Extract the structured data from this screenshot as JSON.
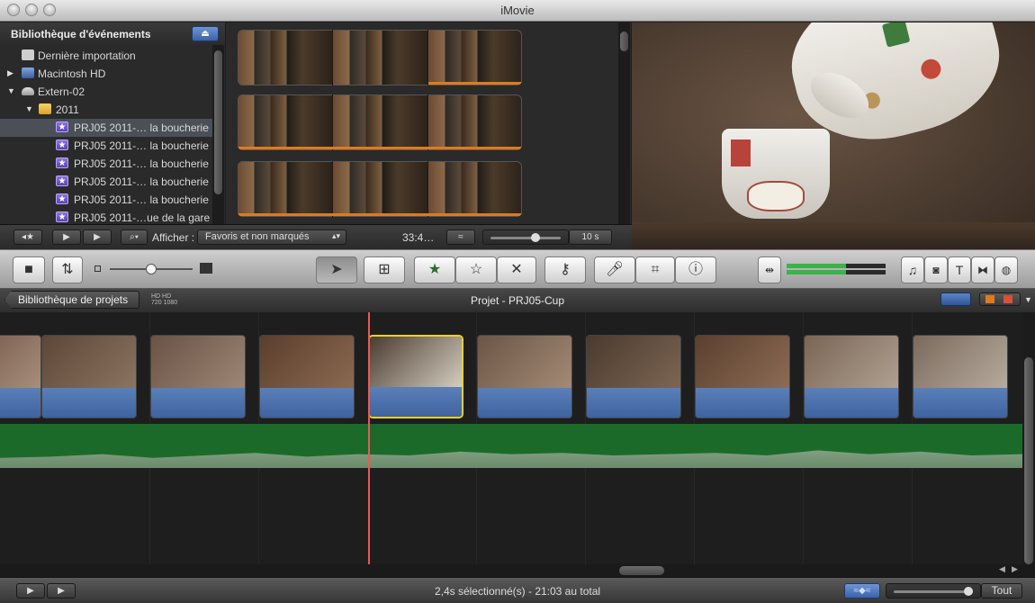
{
  "window": {
    "title": "iMovie"
  },
  "event_library": {
    "title": "Bibliothèque d'événements",
    "items": [
      {
        "label": "Dernière importation",
        "kind": "import"
      },
      {
        "label": "Macintosh HD",
        "kind": "disk"
      },
      {
        "label": "Extern-02",
        "kind": "disk"
      },
      {
        "label": "2011",
        "kind": "calendar"
      },
      {
        "label": "PRJ05 2011-… la boucherie",
        "kind": "event",
        "selected": true
      },
      {
        "label": "PRJ05 2011-… la boucherie",
        "kind": "event"
      },
      {
        "label": "PRJ05 2011-… la boucherie",
        "kind": "event"
      },
      {
        "label": "PRJ05 2011-… la boucherie",
        "kind": "event"
      },
      {
        "label": "PRJ05 2011-… la boucherie",
        "kind": "event"
      },
      {
        "label": "PRJ05 2011-…ue de la gare",
        "kind": "event"
      }
    ]
  },
  "browser_toolbar": {
    "afficher_label": "Afficher :",
    "filter_value": "Favoris et non marqués",
    "duration": "33:4…",
    "zoom_value": "10 s"
  },
  "project": {
    "back_label": "Bibliothèque de projets",
    "title": "Projet - PRJ05-Cup",
    "hd_top": "HD HD",
    "hd_bottom": "720 1080"
  },
  "status": {
    "text": "2,4s sélectionné(s) - 21:03 au total",
    "zoom_all": "Tout"
  },
  "colors": {
    "selection": "#f2d11b",
    "playhead": "#e35c5c",
    "audio_clip": "#4a6fae",
    "event_star": "#6b55c8"
  },
  "clips": [
    {
      "name": "clip-1",
      "palette": [
        "#6b4e3e",
        "#a88f7c"
      ]
    },
    {
      "name": "clip-2",
      "palette": [
        "#5d4636",
        "#8b7561"
      ]
    },
    {
      "name": "clip-3",
      "palette": [
        "#6a5244",
        "#9d8776"
      ]
    },
    {
      "name": "clip-4",
      "palette": [
        "#5a3e2c",
        "#8c6a52"
      ]
    },
    {
      "name": "clip-5",
      "palette": [
        "#4c3c30",
        "#d7d0c4"
      ],
      "selected": true
    },
    {
      "name": "clip-6",
      "palette": [
        "#6d5546",
        "#a38b76"
      ]
    },
    {
      "name": "clip-7",
      "palette": [
        "#4a3a2e",
        "#7d6653"
      ]
    },
    {
      "name": "clip-8",
      "palette": [
        "#5b3f2e",
        "#8c6c55"
      ]
    },
    {
      "name": "clip-9",
      "palette": [
        "#7a6554",
        "#b0a192"
      ]
    },
    {
      "name": "clip-10",
      "palette": [
        "#7b6a5c",
        "#b7ab9e"
      ]
    }
  ]
}
